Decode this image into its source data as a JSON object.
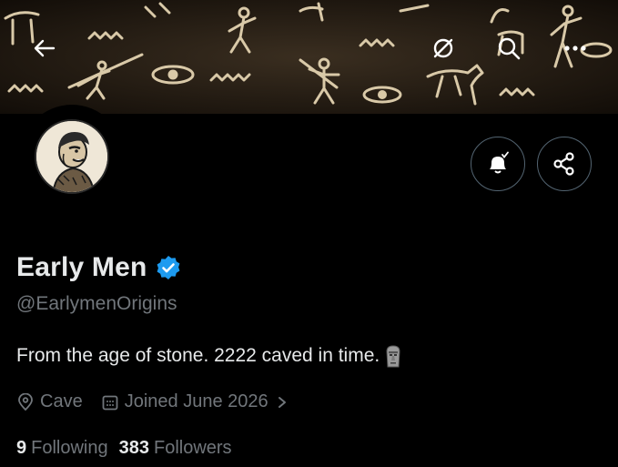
{
  "header": {
    "back_icon": "arrow-left-icon",
    "grok_icon": "slashed-circle-icon",
    "search_icon": "search-icon",
    "more_icon": "more-horizontal-icon"
  },
  "profile": {
    "display_name": "Early Men",
    "verified_badge": "verified-badge-icon",
    "handle": "@EarlymenOrigins",
    "bio": "From the age of stone. 2222 caved in time.",
    "bio_emoji": "moai",
    "location": "Cave",
    "joined": "Joined June 2026",
    "following_count": "9",
    "following_label": "Following",
    "followers_count": "383",
    "followers_label": "Followers"
  },
  "actions": {
    "notify_icon": "bell-check-icon",
    "share_icon": "share-icon"
  },
  "colors": {
    "background": "#000000",
    "primary_text": "#e7e9ea",
    "secondary_text": "#71767b",
    "verified_blue": "#1d9bf0",
    "banner_base": "#1a140d",
    "cave_paint": "#d9c9a8"
  }
}
